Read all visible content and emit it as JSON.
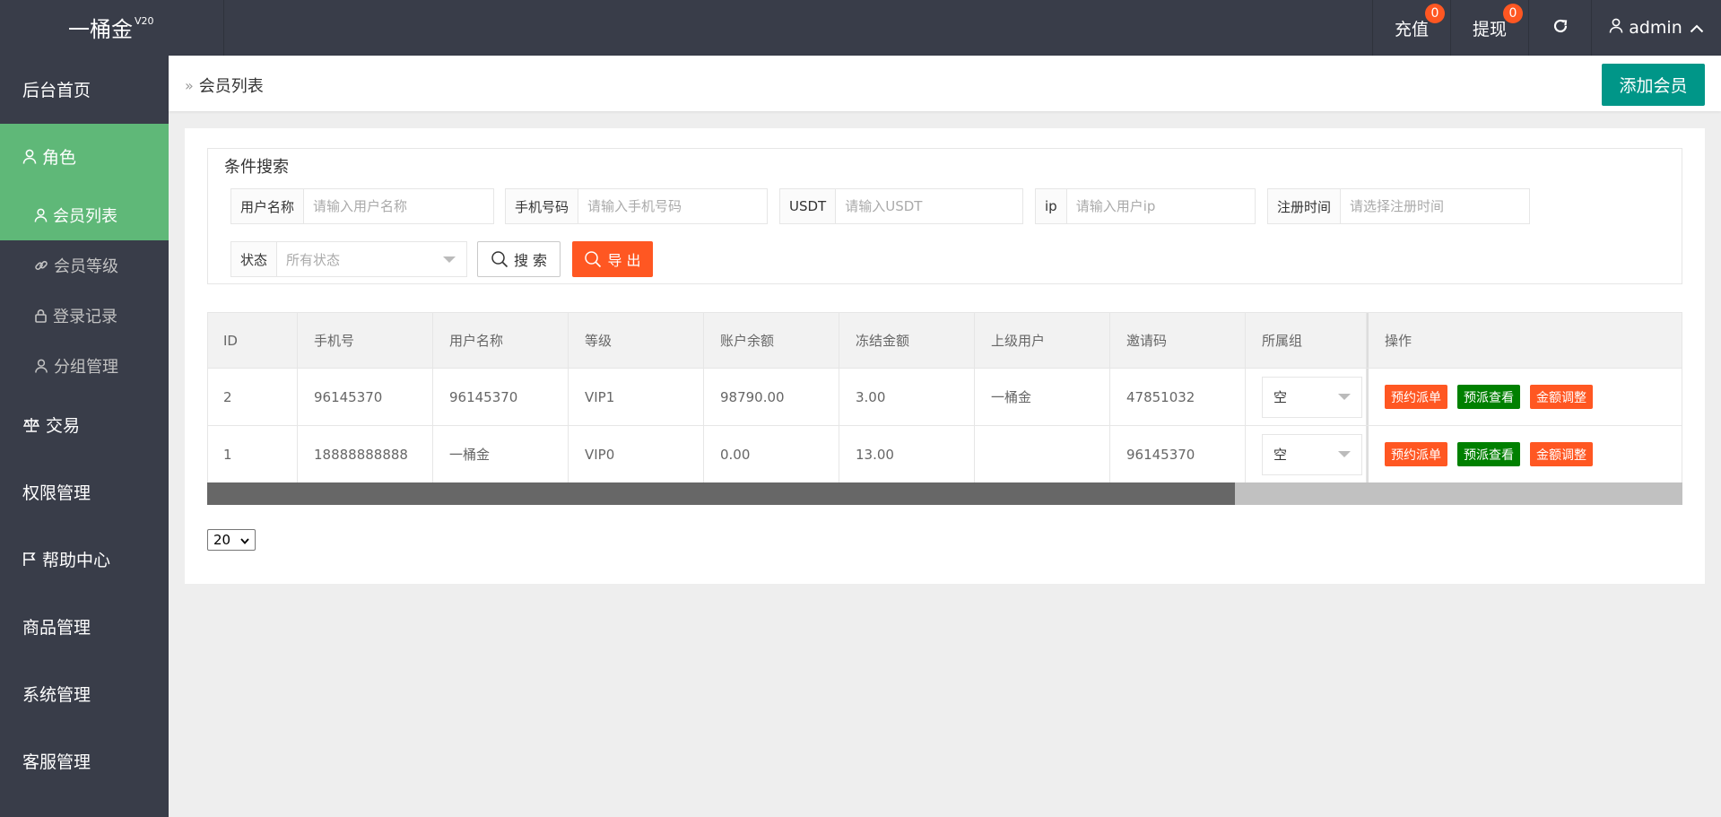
{
  "app": {
    "name": "一桶金",
    "version": "V20"
  },
  "topbar": {
    "recharge": {
      "label": "充值",
      "badge": "0"
    },
    "withdraw": {
      "label": "提现",
      "badge": "0"
    },
    "refresh_icon": "refresh-icon",
    "user": {
      "name": "admin"
    }
  },
  "sidebar": {
    "home": "后台首页",
    "role": "角色",
    "role_children": [
      "会员列表",
      "会员等级",
      "登录记录",
      "分组管理"
    ],
    "trade": "交易",
    "permission": "权限管理",
    "help": "帮助中心",
    "goods": "商品管理",
    "system": "系统管理",
    "service": "客服管理"
  },
  "page": {
    "breadcrumb": "会员列表",
    "add_button": "添加会员"
  },
  "search": {
    "legend": "条件搜索",
    "fields": [
      {
        "label": "用户名称",
        "placeholder": "请输入用户名称"
      },
      {
        "label": "手机号码",
        "placeholder": "请输入手机号码"
      },
      {
        "label": "USDT",
        "placeholder": "请输入USDT"
      },
      {
        "label": "ip",
        "placeholder": "请输入用户ip"
      },
      {
        "label": "注册时间",
        "placeholder": "请选择注册时间"
      }
    ],
    "status": {
      "label": "状态",
      "value": "所有状态"
    },
    "search_button": "搜 索",
    "export_button": "导 出"
  },
  "table": {
    "headers": [
      "ID",
      "手机号",
      "用户名称",
      "等级",
      "账户余额",
      "冻结金额",
      "上级用户",
      "邀请码",
      "所属组",
      "操作"
    ],
    "rows": [
      {
        "id": "2",
        "phone": "96145370",
        "username": "96145370",
        "level": "VIP1",
        "balance": "98790.00",
        "frozen": "3.00",
        "parent": "一桶金",
        "invite": "47851032",
        "group": "空"
      },
      {
        "id": "1",
        "phone": "18888888888",
        "username": "一桶金",
        "level": "VIP0",
        "balance": "0.00",
        "frozen": "13.00",
        "parent": "",
        "invite": "96145370",
        "group": "空"
      }
    ],
    "actions": [
      "预约派单",
      "预派查看",
      "金额调整"
    ],
    "colors": {
      "orange": "#ff5722",
      "green": "#008000"
    }
  },
  "pager": {
    "page_size": "20"
  },
  "colors": {
    "header_bg": "#393d49",
    "active_nav": "#5fb878",
    "primary": "#009688",
    "danger": "#ff5722"
  }
}
